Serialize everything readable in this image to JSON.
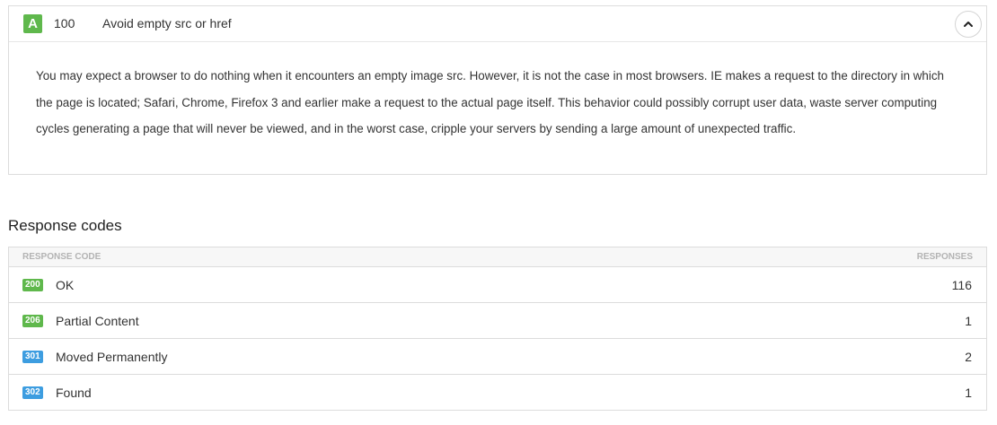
{
  "rule": {
    "grade": "A",
    "score": "100",
    "title": "Avoid empty src or href",
    "description": "You may expect a browser to do nothing when it encounters an empty image src. However, it is not the case in most browsers. IE makes a request to the directory in which the page is located; Safari, Chrome, Firefox 3 and earlier make a request to the actual page itself. This behavior could possibly corrupt user data, waste server computing cycles generating a page that will never be viewed, and in the worst case, cripple your servers by sending a large amount of unexpected traffic.",
    "grade_color": "#5fb84c",
    "collapse_icon": "chevron-up-icon"
  },
  "response_codes": {
    "title": "Response codes",
    "columns": {
      "code": "Response code",
      "responses": "Responses"
    },
    "rows": [
      {
        "code": "200",
        "label": "OK",
        "count": "116",
        "color": "#5fb84c"
      },
      {
        "code": "206",
        "label": "Partial Content",
        "count": "1",
        "color": "#5fb84c"
      },
      {
        "code": "301",
        "label": "Moved Permanently",
        "count": "2",
        "color": "#3d9de0"
      },
      {
        "code": "302",
        "label": "Found",
        "count": "1",
        "color": "#3d9de0"
      }
    ]
  }
}
